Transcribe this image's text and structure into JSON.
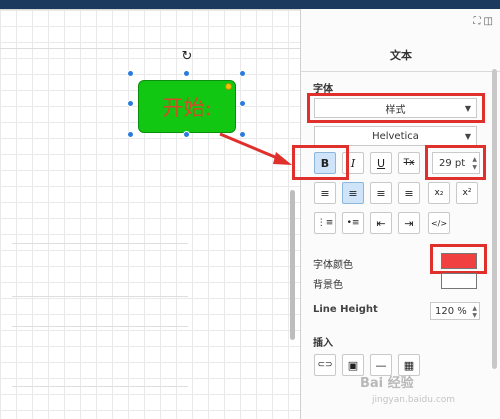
{
  "shape": {
    "text": "开始:"
  },
  "toolbar_icons": {
    "fit": "⛶",
    "panel": "◫"
  },
  "panel": {
    "title": "文本",
    "font_section": "字体",
    "style_select": "样式",
    "font_select": "Helvetica",
    "format_buttons": {
      "bold": "B",
      "italic": "I",
      "underline": "U",
      "clear": "Tx"
    },
    "font_size": "29 pt",
    "align_buttons": [
      "≡",
      "≡",
      "≡",
      "≡"
    ],
    "script_buttons": {
      "subscript": "x₂",
      "superscript": "x²"
    },
    "list_buttons": {
      "numbered": "⋮≡",
      "bulleted": "•≡",
      "outdent": "⇤",
      "indent": "⇥",
      "html": "</>"
    },
    "font_color_label": "字体颜色",
    "bg_color_label": "背景色",
    "line_height_label": "Line Height",
    "line_height_value": "120 %",
    "insert_label": "插入",
    "insert_buttons": {
      "link": "⊂⊃",
      "image": "▣",
      "hr": "—",
      "table": "▦"
    }
  },
  "colors": {
    "font_color": "#f04040",
    "bg_color": "#ffffff",
    "shape_fill": "#11c711",
    "highlight": "#e0302b"
  },
  "watermark": {
    "text": "Bai 经验",
    "sub": "jingyan.baidu.com"
  }
}
